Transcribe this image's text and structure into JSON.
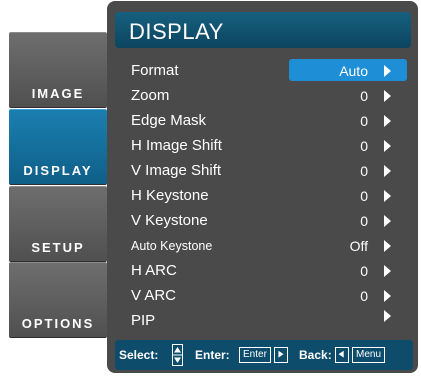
{
  "title": "DISPLAY",
  "sidebar": {
    "tabs": [
      {
        "label": "IMAGE",
        "active": false
      },
      {
        "label": "DISPLAY",
        "active": true
      },
      {
        "label": "SETUP",
        "active": false
      },
      {
        "label": "OPTIONS",
        "active": false
      }
    ]
  },
  "menu": {
    "items": [
      {
        "label": "Format",
        "value": "Auto",
        "selected": true
      },
      {
        "label": "Zoom",
        "value": "0"
      },
      {
        "label": "Edge Mask",
        "value": "0"
      },
      {
        "label": "H Image Shift",
        "value": "0"
      },
      {
        "label": "V Image Shift",
        "value": "0"
      },
      {
        "label": "H Keystone",
        "value": "0"
      },
      {
        "label": "V Keystone",
        "value": "0"
      },
      {
        "label": "Auto Keystone",
        "value": "Off"
      },
      {
        "label": "H ARC",
        "value": "0"
      },
      {
        "label": "V ARC",
        "value": "0"
      },
      {
        "label": "PIP",
        "value": ""
      }
    ]
  },
  "footer": {
    "select_label": "Select:",
    "enter_label": "Enter:",
    "enter_key": "Enter",
    "back_label": "Back:",
    "menu_key": "Menu"
  },
  "colors": {
    "panel": "#4a4a4a",
    "accent": "#1e8fd6",
    "title_bar": "#16607f",
    "footer": "#0e4c6c"
  }
}
